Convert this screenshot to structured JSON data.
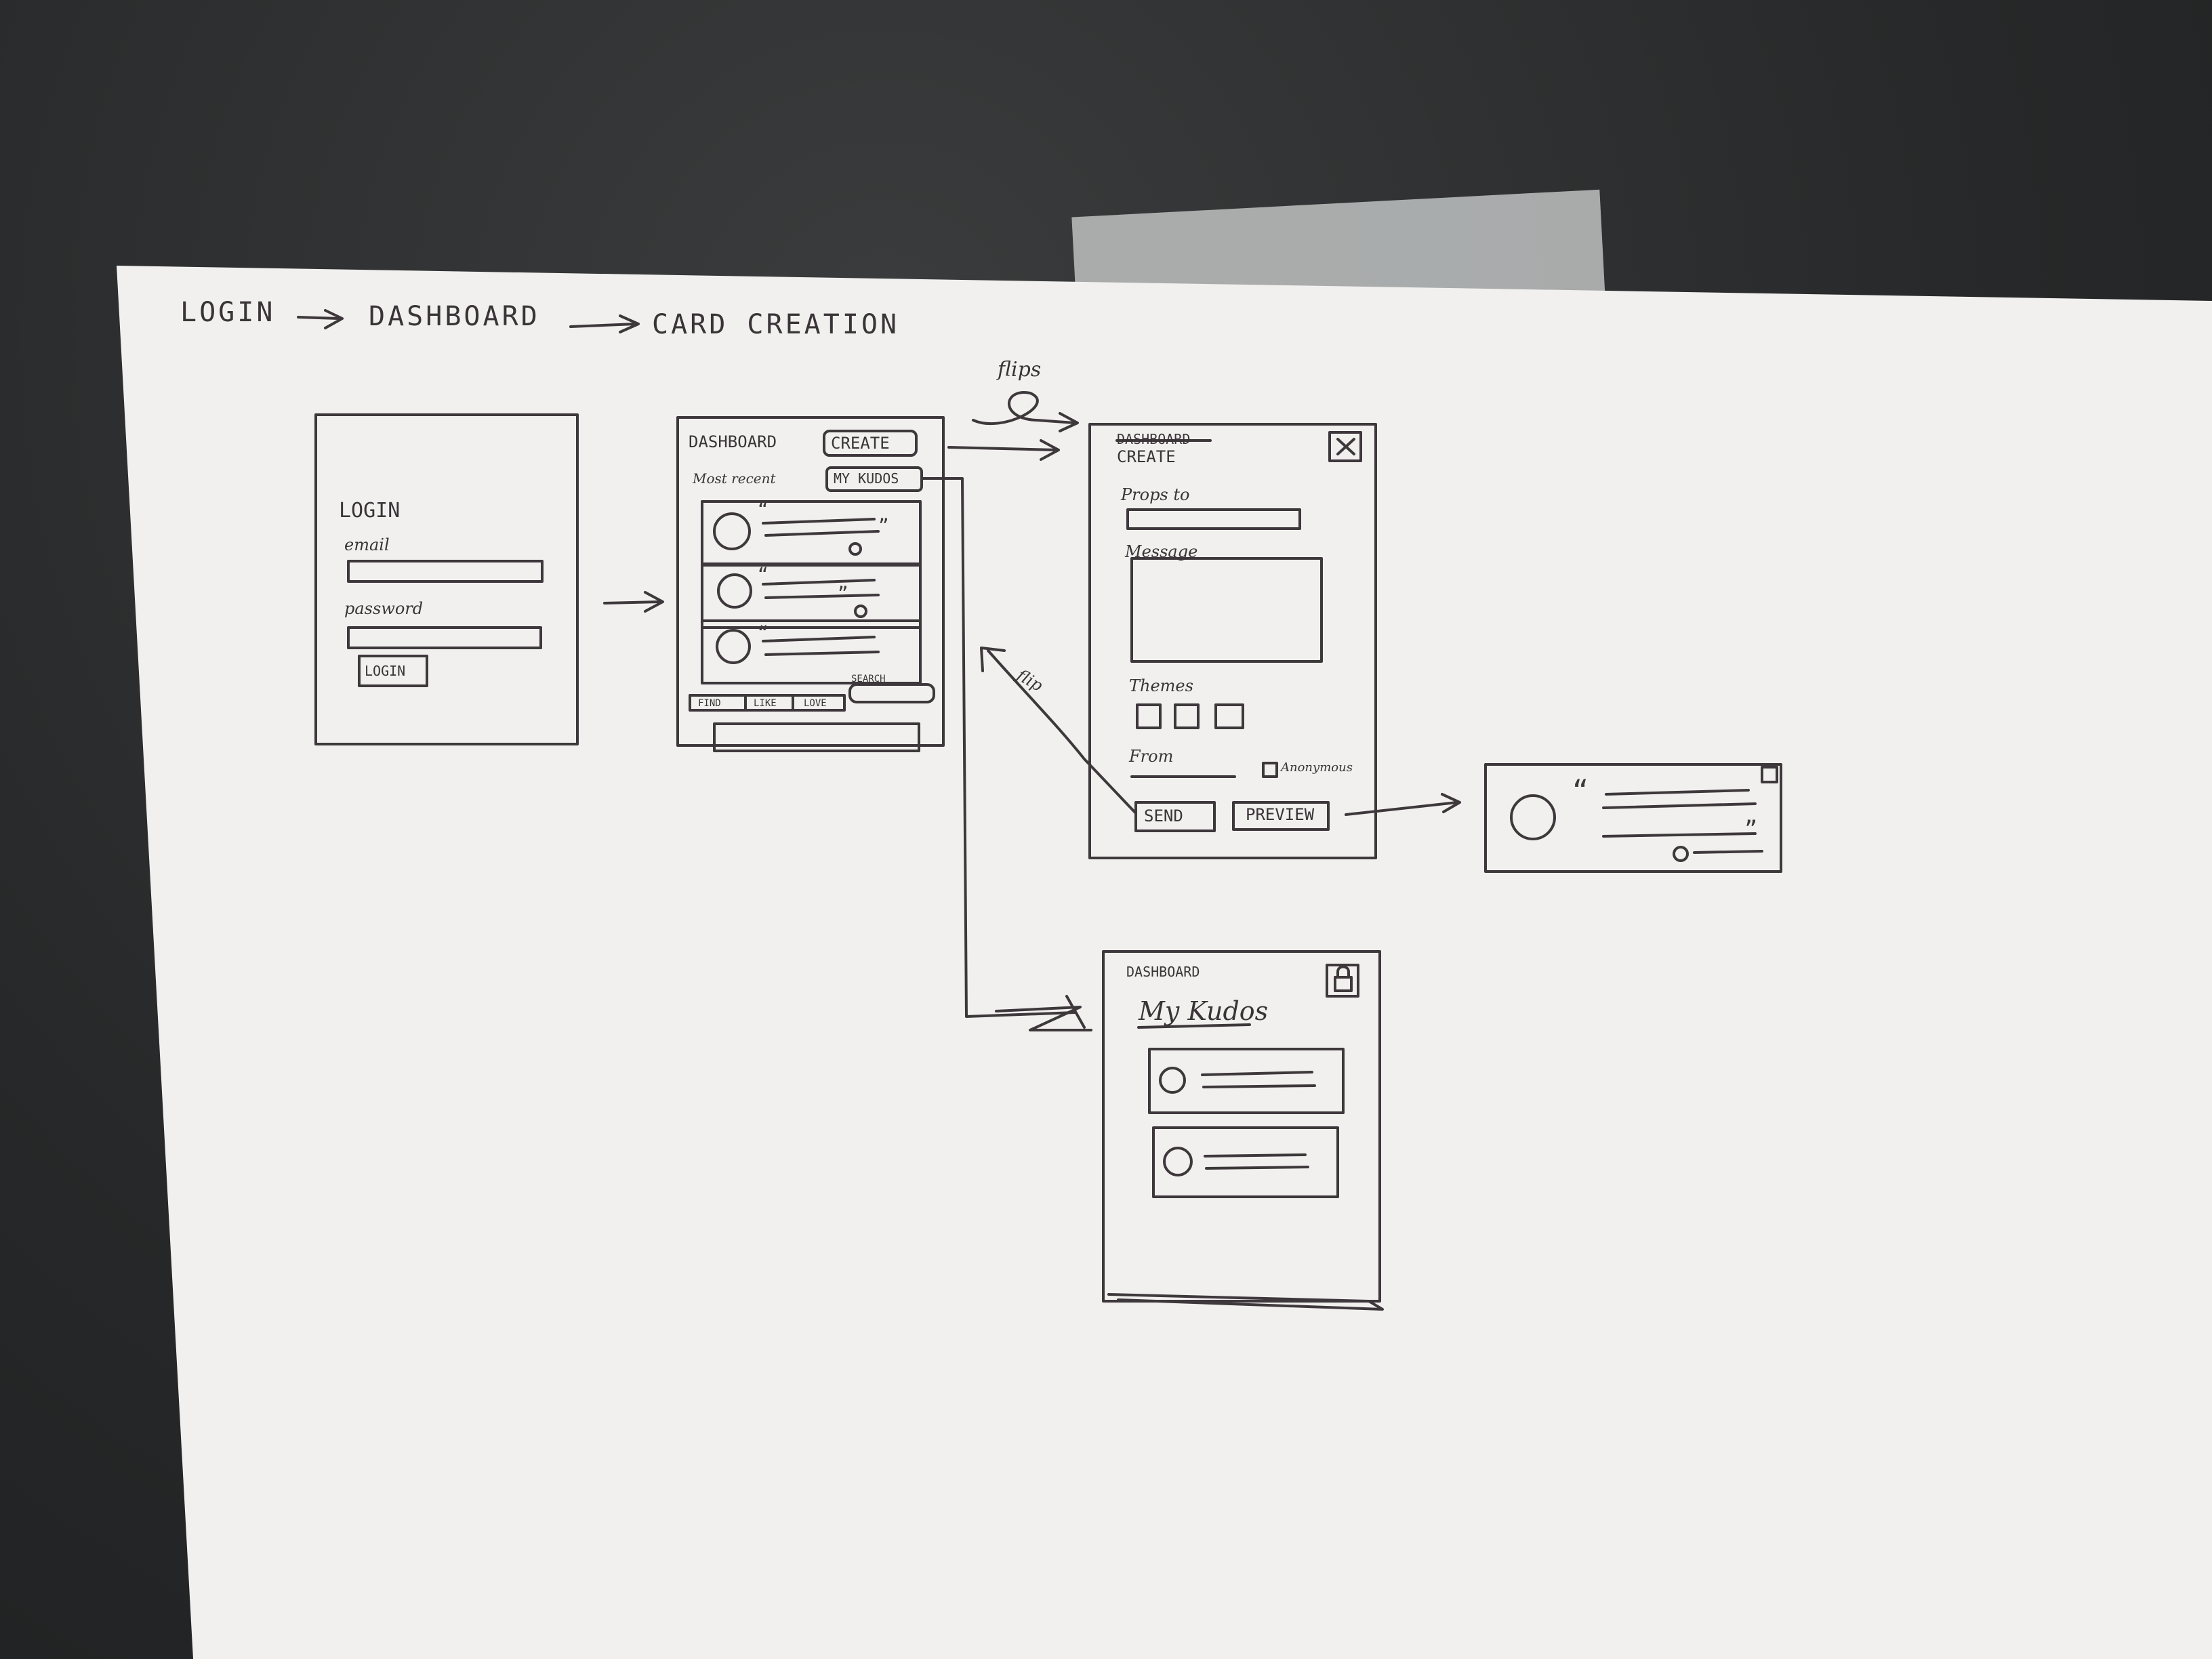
{
  "flow_header": {
    "step1": "LOGIN",
    "step2": "DASHBOARD",
    "step3": "CARD CREATION"
  },
  "login": {
    "title": "LOGIN",
    "email_label": "email",
    "password_label": "password",
    "button": "LOGIN"
  },
  "dashboard": {
    "title": "DASHBOARD",
    "create_button": "CREATE",
    "most_recent_label": "Most recent",
    "my_kudos_button": "MY KUDOS",
    "search_button": "SEARCH",
    "tabs": [
      "FIND",
      "LIKE",
      "LOVE"
    ]
  },
  "create": {
    "struck_title": "DASHBOARD",
    "title": "CREATE",
    "props_label": "Props to",
    "message_label": "Message",
    "themes_label": "Themes",
    "from_label": "From",
    "anonymous_label": "Anonymous",
    "send_button": "SEND",
    "preview_button": "PREVIEW"
  },
  "my_kudos": {
    "header": "DASHBOARD",
    "title": "My Kudos"
  },
  "annotations": {
    "flips_top": "flips",
    "flip_side": "flip"
  }
}
